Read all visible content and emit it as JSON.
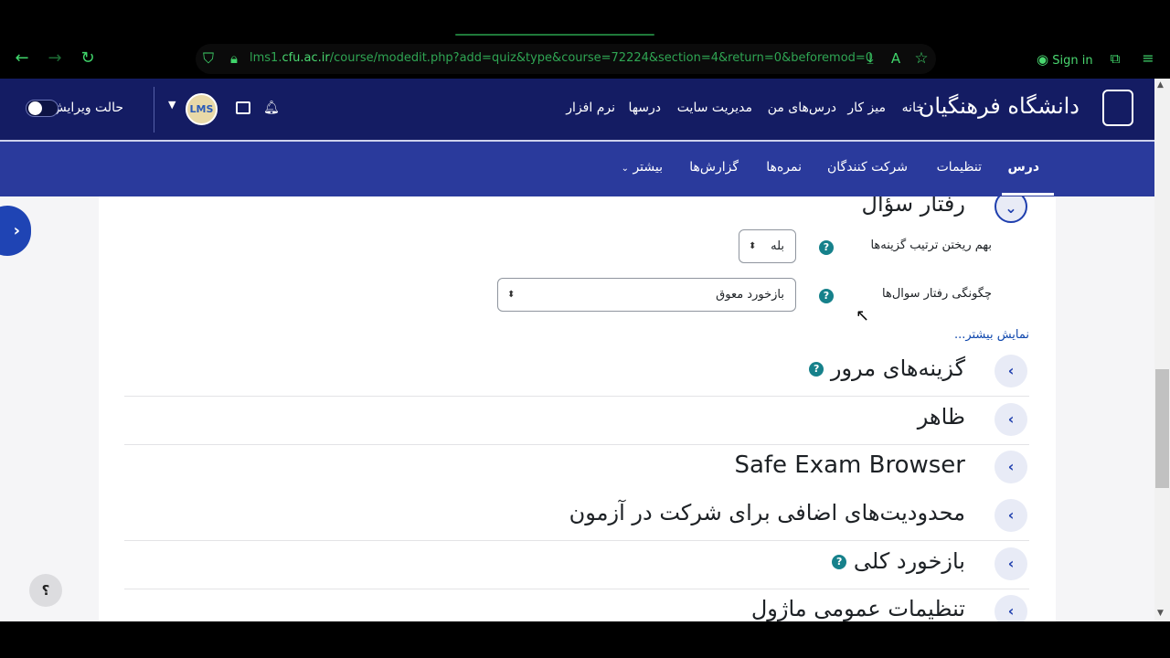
{
  "browser": {
    "url_prefix": "lms1.",
    "url_host": "cfu.ac.ir",
    "url_path": "/course/modedit.php?add=quiz&type&course=72224&section=4&return=0&beforemod=0",
    "signin_label": "Sign in"
  },
  "header": {
    "logo_text": "دانشگاه فرهنگیان",
    "nav_items": [
      "خانه",
      "میز کار",
      "درس‌های من",
      "مدیریت سایت",
      "درسها",
      "نرم افزار"
    ],
    "edit_mode_label": "حالت ویرایش",
    "avatar_text": "LMS"
  },
  "secondary_nav": {
    "items": [
      "درس",
      "تنظیمات",
      "شرکت کنندگان",
      "نمره‌ها",
      "گزارش‌ها",
      "بیشتر"
    ],
    "active": "درس"
  },
  "question_behaviour": {
    "title": "رفتار سؤال",
    "shuffle_label": "بهم ریختن ترتیب گزینه‌ها",
    "shuffle_value": "بله",
    "behaviour_label": "چگونگی رفتار سوال‌ها",
    "behaviour_value": "بازخورد معوق",
    "show_more": "نمایش بیشتر..."
  },
  "sections": [
    {
      "title": "گزینه‌های مرور",
      "help": true
    },
    {
      "title": "ظاهر",
      "help": false
    },
    {
      "title": "Safe Exam Browser",
      "help": false
    },
    {
      "title": "محدودیت‌های اضافی برای شرکت در آزمون",
      "help": false
    },
    {
      "title": "بازخورد کلی",
      "help": true
    },
    {
      "title": "تنظیمات عمومی ماژول",
      "help": false
    }
  ],
  "help_button": "؟",
  "colors": {
    "navbar": "#141c63",
    "secondary_nav": "#2a3a9c",
    "accent": "#1f44b4",
    "help_icon": "#16818b"
  }
}
